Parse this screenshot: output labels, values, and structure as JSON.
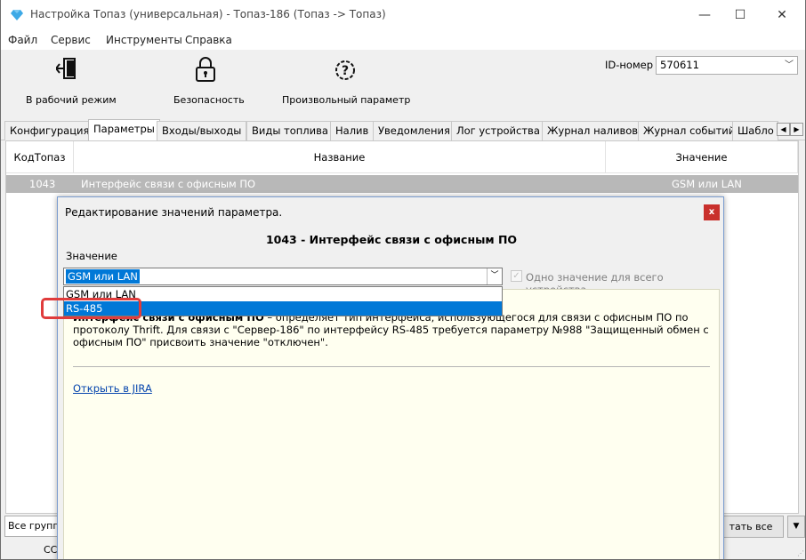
{
  "window": {
    "title": "Настройка Топаз (универсальная) - Топаз-186 (Топаз -> Топаз)"
  },
  "menu": [
    "Файл",
    "Сервис",
    "Инструменты",
    "Справка"
  ],
  "toolbar": {
    "work_mode": "В рабочий режим",
    "security": "Безопасность",
    "custom_param": "Произвольный параметр",
    "id_label": "ID-номер",
    "id_value": "570611"
  },
  "tabs": [
    "Конфигурация",
    "Параметры",
    "Входы/выходы",
    "Виды топлива",
    "Налив",
    "Уведомления",
    "Лог устройства",
    "Журнал наливов",
    "Журнал событий",
    "Шабло"
  ],
  "table": {
    "headers": [
      "КодТопаз",
      "Название",
      "Значение"
    ],
    "selected_row": {
      "code": "1043",
      "name": "Интерфейс связи с офисным ПО",
      "value": "GSM или LAN"
    }
  },
  "bottom": {
    "left_combo": "Все группы",
    "left_text": "СС",
    "right_button": "тать все"
  },
  "dialog": {
    "title": "Редактирование значений параметра.",
    "close": "x",
    "heading": "1043 - Интерфейс связи с офисным ПО",
    "value_label": "Значение",
    "current_value": "GSM или LAN",
    "options": [
      "GSM или LAN",
      "RS-485"
    ],
    "highlighted_option": "RS-485",
    "checkbox_label": "Одно значение для всего устройства",
    "description_bold": "Интерфейс связи с офисным ПО",
    "description_rest": " – определяет тип интерфейса, использующегося для связи с офисным ПО по протоколу Thrift. Для связи с \"Сервер-186\" по интерфейсу RS-485 требуется параметру №988 \"Защищенный обмен с офисным ПО\" присвоить значение \"отключен\".",
    "link": "Открыть в JIRA"
  },
  "colors": {
    "accent": "#0078d7",
    "callout": "#e03c3c",
    "dialog_close": "#c9302c",
    "description_bg": "#fffff0",
    "selected_row": "#b8b8b8"
  }
}
